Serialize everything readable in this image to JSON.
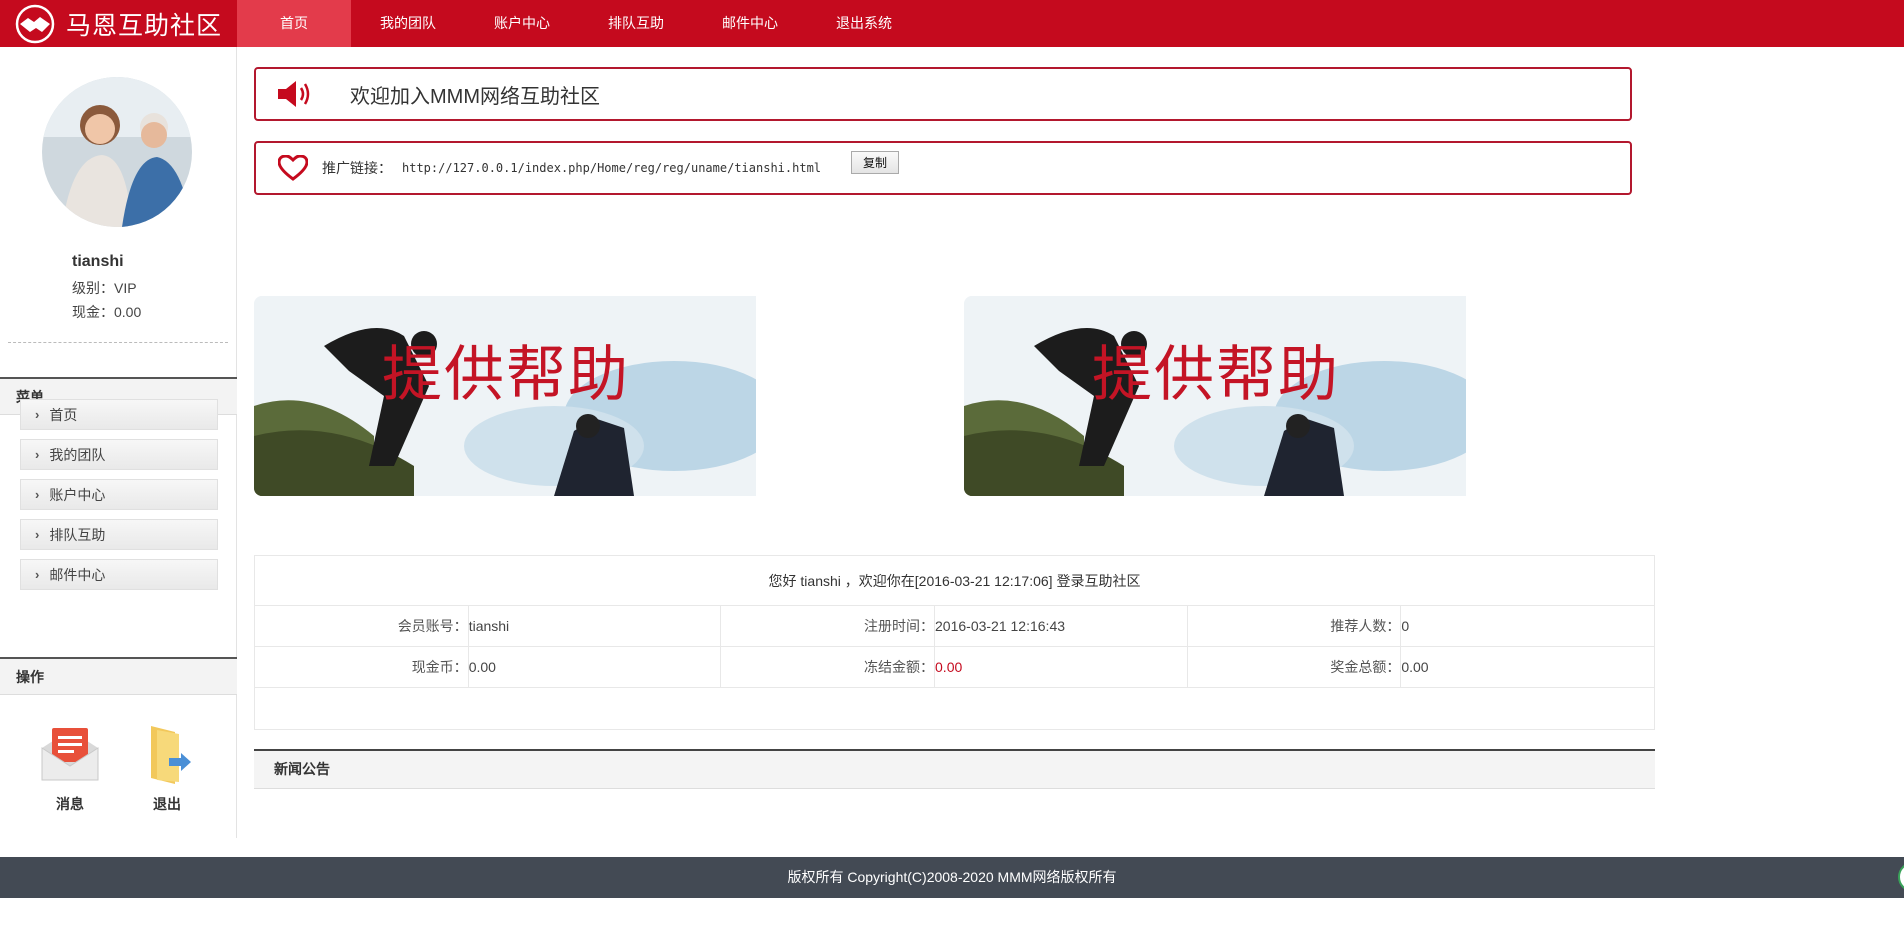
{
  "header": {
    "logo_text": "马恩互助社区",
    "nav": [
      {
        "label": "首页",
        "active": true
      },
      {
        "label": "我的团队"
      },
      {
        "label": "账户中心"
      },
      {
        "label": "排队互助"
      },
      {
        "label": "邮件中心"
      },
      {
        "label": "退出系统"
      }
    ]
  },
  "sidebar": {
    "user": {
      "name": "tianshi",
      "level": "级别：VIP",
      "cash": "现金：0.00"
    },
    "menu_title": "菜单",
    "menu": [
      "首页",
      "我的团队",
      "账户中心",
      "排队互助",
      "邮件中心"
    ],
    "ops_title": "操作",
    "ops": [
      {
        "label": "消息",
        "icon": "mail-icon"
      },
      {
        "label": "退出",
        "icon": "folder-exit-icon"
      }
    ]
  },
  "main": {
    "notice": "欢迎加入MMM网络互助社区",
    "promo": {
      "label": "推广链接：",
      "url": "http://127.0.0.1/index.php/Home/reg/reg/uname/tianshi.html",
      "copy_label": "复制"
    },
    "banners": [
      {
        "title": "提供帮助"
      },
      {
        "title": "提供帮助"
      }
    ],
    "welcome": "您好 tianshi ，欢迎你在[2016-03-21 12:17:06] 登录互助社区",
    "info": {
      "row1": [
        {
          "label": "会员账号：",
          "value": "tianshi"
        },
        {
          "label": "注册时间：",
          "value": "2016-03-21 12:16:43"
        },
        {
          "label": "推荐人数：",
          "value": "0"
        }
      ],
      "row2": [
        {
          "label": "现金币：",
          "value": "0.00"
        },
        {
          "label": "冻结金额：",
          "value": "0.00"
        },
        {
          "label": "奖金总额：",
          "value": "0.00"
        }
      ]
    },
    "news_title": "新闻公告"
  },
  "footer": {
    "text": "版权所有 Copyright(C)2008-2020 MMM网络版权所有"
  },
  "colors": {
    "brand": "#c50a1e",
    "nav_active": "#e33b4b",
    "footer": "#434a54"
  }
}
